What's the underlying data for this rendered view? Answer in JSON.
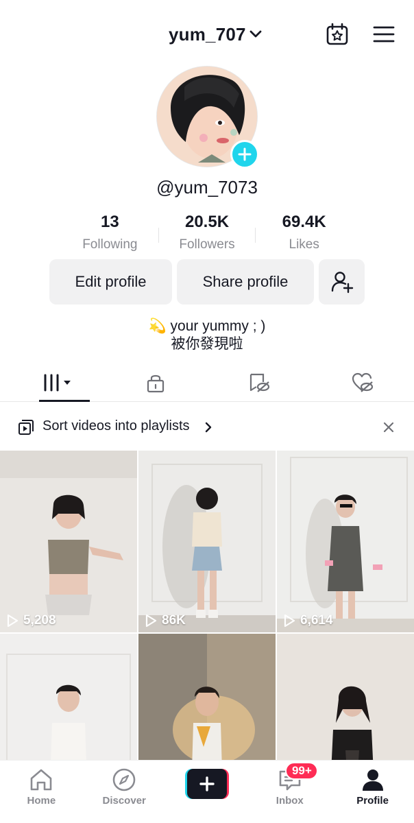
{
  "header": {
    "username": "yum_707",
    "icons": {
      "dropdown": "chevron-down-icon",
      "calendar": "calendar-star-icon",
      "menu": "hamburger-menu-icon"
    }
  },
  "profile": {
    "handle": "@yum_7073",
    "avatar_plus": "plus-icon"
  },
  "stats": [
    {
      "value": "13",
      "label": "Following"
    },
    {
      "value": "20.5K",
      "label": "Followers"
    },
    {
      "value": "69.4K",
      "label": "Likes"
    }
  ],
  "actions": {
    "edit_label": "Edit profile",
    "share_label": "Share profile",
    "add_friend_icon": "add-friend-icon"
  },
  "bio": {
    "line1": "💫 your yummy ; )",
    "line2": "被你發現啦"
  },
  "tabs": [
    {
      "icon": "videos-grid-icon",
      "active": true
    },
    {
      "icon": "private-lock-icon",
      "active": false
    },
    {
      "icon": "reposts-icon",
      "active": false
    },
    {
      "icon": "liked-hidden-icon",
      "active": false
    }
  ],
  "playlist_banner": {
    "text": "Sort videos into playlists",
    "chevron": "›"
  },
  "videos": [
    {
      "views": "5,208"
    },
    {
      "views": "86K"
    },
    {
      "views": "6,614"
    },
    {
      "views": ""
    },
    {
      "views": ""
    },
    {
      "views": ""
    }
  ],
  "nav": {
    "home": "Home",
    "discover": "Discover",
    "inbox": "Inbox",
    "inbox_badge": "99+",
    "profile": "Profile"
  },
  "colors": {
    "accent_cyan": "#20d5ec",
    "accent_pink": "#fe2c55",
    "text_primary": "#161823",
    "text_secondary": "#8a8b91",
    "button_bg": "#f1f1f2"
  }
}
